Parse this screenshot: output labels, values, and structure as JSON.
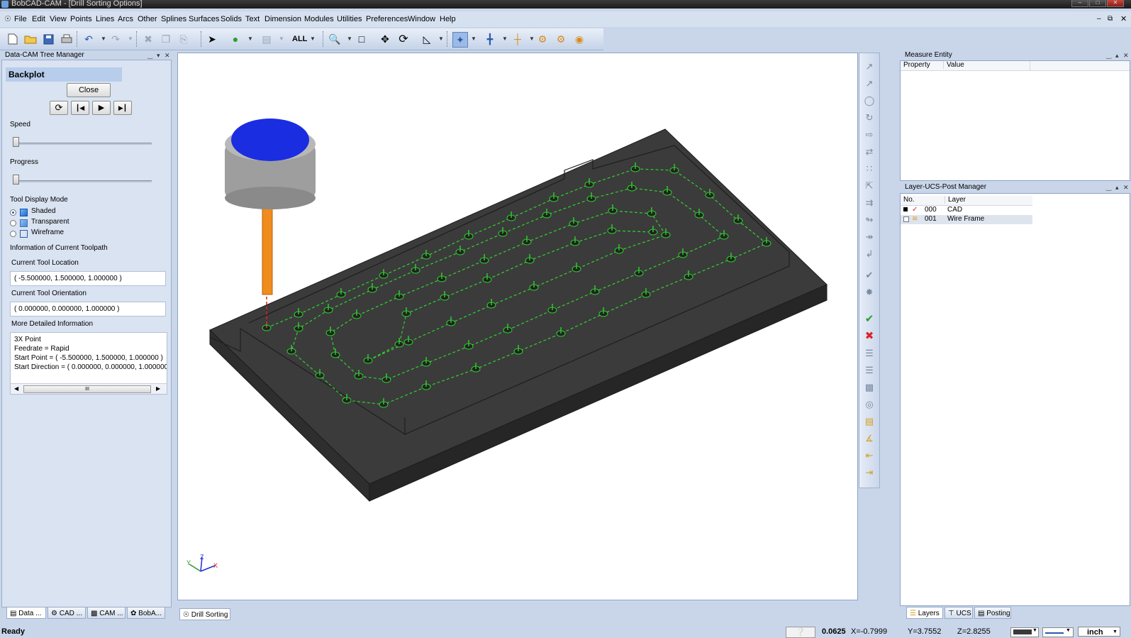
{
  "window": {
    "title": "BobCAD-CAM - [Drill Sorting Options]"
  },
  "menu": [
    "File",
    "Edit",
    "View",
    "Points",
    "Lines",
    "Arcs",
    "Other",
    "Splines",
    "Surfaces",
    "Solids",
    "Text",
    "Dimension",
    "Modules",
    "Utilities",
    "Preferences",
    "Window",
    "Help"
  ],
  "toolbar": {
    "all_label": "ALL"
  },
  "left_panel": {
    "header": "Data-CAM Tree Manager",
    "title": "Backplot",
    "close_label": "Close",
    "speed_label": "Speed",
    "speed_value": 0.0,
    "progress_label": "Progress",
    "progress_value": 0.0,
    "tool_display_mode_label": "Tool Display Mode",
    "modes": [
      "Shaded",
      "Transparent",
      "Wireframe"
    ],
    "selected_mode": "Shaded",
    "info_heading": "Information of Current Toolpath",
    "location_label": "Current Tool Location",
    "location_value": "( -5.500000, 1.500000, 1.000000 )",
    "orientation_label": "Current Tool Orientation",
    "orientation_value": "( 0.000000, 0.000000, 1.000000 )",
    "details_label": "More Detailed Information",
    "details_lines": [
      "3X Point",
      "Feedrate = Rapid",
      "Start Point = ( -5.500000, 1.500000, 1.000000 )",
      "Start Direction = ( 0.000000, 0.000000, 1.000000"
    ],
    "scroll_grip": "III",
    "tabs": [
      "Data ...",
      "CAD ...",
      "CAM ...",
      "BobA..."
    ]
  },
  "viewport": {
    "tab_label": "Drill Sorting ...",
    "axis_x": "X",
    "axis_y": "Y",
    "axis_z": "Z"
  },
  "measure_panel": {
    "header": "Measure Entity",
    "columns": [
      "Property",
      "Value"
    ]
  },
  "layer_panel": {
    "header": "Layer-UCS-Post Manager",
    "columns": [
      "No.",
      "Layer"
    ],
    "rows": [
      {
        "no": "000",
        "layer": "CAD"
      },
      {
        "no": "001",
        "layer": "Wire Frame"
      }
    ],
    "tabs": [
      "Layers",
      "UCS",
      "Posting"
    ]
  },
  "status": {
    "ready": "Ready",
    "value": "0.0625",
    "x": "X=-0.7999",
    "y": "Y=3.7552",
    "z": "Z=2.8255",
    "unit": "inch"
  },
  "colors": {
    "toolpath": "#2fd12f",
    "part": "#3c3c3c",
    "tool_holder": "#1b2de0",
    "tool_shank": "#f08c1e",
    "rapid": "#e02020"
  }
}
